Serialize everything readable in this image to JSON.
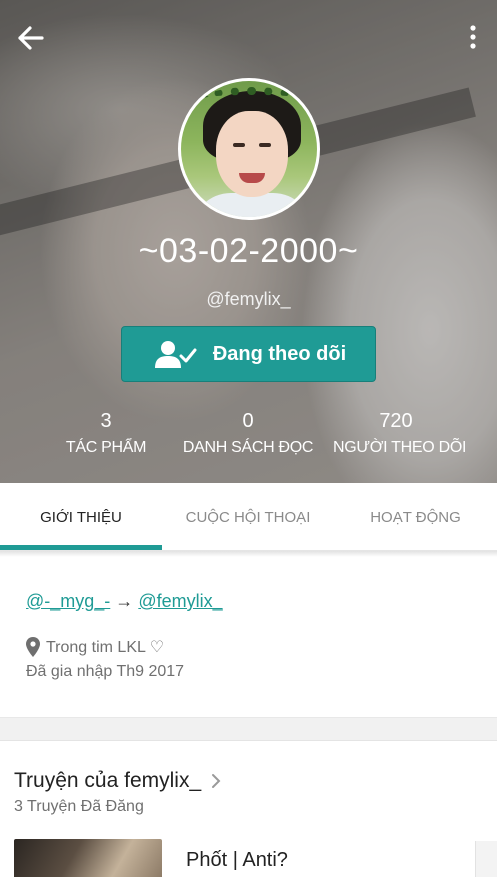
{
  "profile": {
    "display_name": "~03-02-2000~",
    "username": "@femylix_",
    "follow_label": "Đang theo dõi"
  },
  "stats": [
    {
      "value": "3",
      "label": "TÁC PHẨM"
    },
    {
      "value": "0",
      "label": "DANH SÁCH ĐỌC"
    },
    {
      "value": "720",
      "label": "NGƯỜI THEO DÕI"
    }
  ],
  "tabs": [
    {
      "label": "GIỚI THIỆU",
      "active": true
    },
    {
      "label": "CUỘC HỘI THOẠI",
      "active": false
    },
    {
      "label": "HOẠT ĐỘNG",
      "active": false
    }
  ],
  "about": {
    "bio_link_1": "@-_myg_-",
    "bio_arrow": " → ",
    "bio_link_2": "@femylix_",
    "location": "Trong tim LKL ♡",
    "joined": "Đã gia nhập Th9 2017"
  },
  "stories": {
    "title": "Truyện của femylix_",
    "count": "3 Truyện Đã Đăng",
    "items": [
      {
        "title": "Phốt | Anti?"
      }
    ]
  },
  "colors": {
    "accent": "#1f9b95",
    "icon_names": [
      "back-arrow-icon",
      "more-vertical-icon",
      "following-user-check-icon",
      "location-pin-icon",
      "chevron-right-icon"
    ]
  }
}
